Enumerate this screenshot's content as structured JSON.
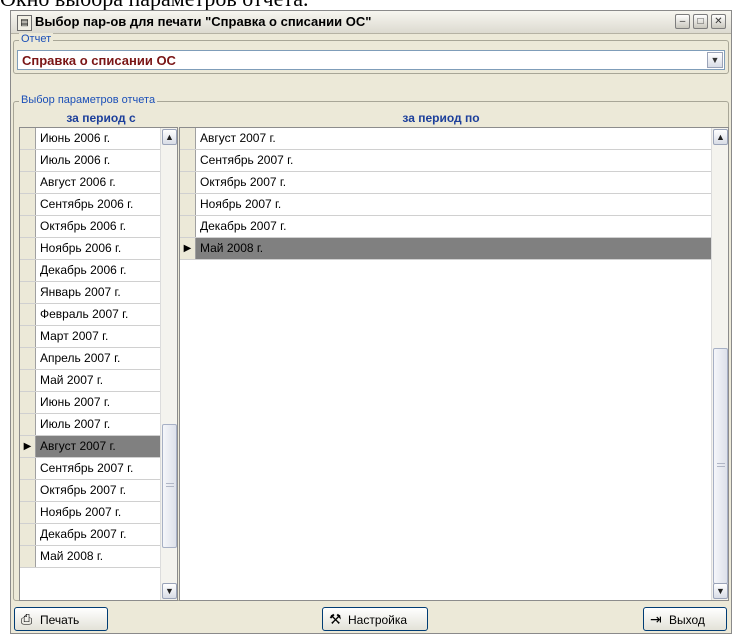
{
  "caption": "Окно выбора параметров отчета.",
  "window": {
    "title": "Выбор пар-ов для печати \"Справка о списании ОС\"",
    "icon": "document-icon",
    "controls": [
      "minimize",
      "maximize",
      "close"
    ]
  },
  "report_group": {
    "legend": "Отчет",
    "selected": "Справка о списании ОС"
  },
  "params_group": {
    "legend": "Выбор параметров отчета",
    "from_header": "за период с",
    "to_header": "за период по"
  },
  "from_list": {
    "items": [
      "Июнь 2006 г.",
      "Июль 2006 г.",
      "Август 2006 г.",
      "Сентябрь 2006 г.",
      "Октябрь 2006 г.",
      "Ноябрь 2006 г.",
      "Декабрь 2006 г.",
      "Январь 2007 г.",
      "Февраль 2007 г.",
      "Март 2007 г.",
      "Апрель 2007 г.",
      "Май 2007 г.",
      "Июнь 2007 г.",
      "Июль 2007 г.",
      "Август 2007 г.",
      "Сентябрь 2007 г.",
      "Октябрь 2007 г.",
      "Ноябрь 2007 г.",
      "Декабрь 2007 г.",
      "Май 2008 г."
    ],
    "selected_index": 14
  },
  "to_list": {
    "items": [
      "Август 2007 г.",
      "Сентябрь 2007 г.",
      "Октябрь 2007 г.",
      "Ноябрь 2007 г.",
      "Декабрь 2007 г.",
      "Май 2008 г."
    ],
    "selected_index": 5
  },
  "buttons": {
    "print": "Печать",
    "settings": "Настройка",
    "exit": "Выход"
  },
  "icons": {
    "print": "printer-icon",
    "settings": "tools-icon",
    "exit": "door-exit-icon"
  },
  "colors": {
    "window_bg": "#ece9d8",
    "header_text": "#1c3f9b",
    "report_text": "#7a1515",
    "selected_row": "#808080"
  }
}
